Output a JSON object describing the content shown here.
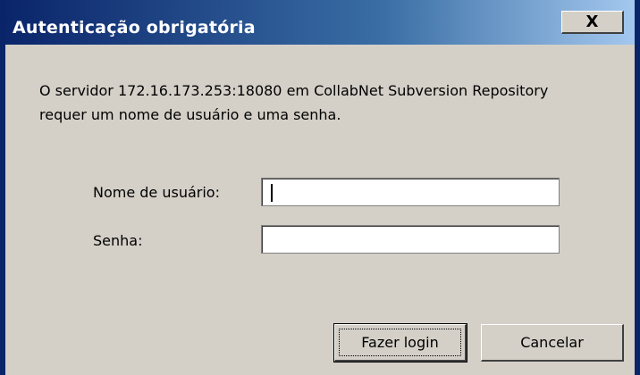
{
  "dialog": {
    "title": "Autenticação obrigatória",
    "close_glyph": "X",
    "message": "O servidor 172.16.173.253:18080 em CollabNet Subversion Repository requer um nome de usuário e uma senha.",
    "username_label": "Nome de usuário:",
    "username_value": "",
    "password_label": "Senha:",
    "password_value": "",
    "login_button": "Fazer login",
    "cancel_button": "Cancelar"
  },
  "colors": {
    "titlebar_start": "#0a246a",
    "titlebar_end": "#a6caf0",
    "face": "#d4d0c8",
    "title_text": "#ffffff"
  },
  "icons": {
    "close": "close-icon"
  }
}
